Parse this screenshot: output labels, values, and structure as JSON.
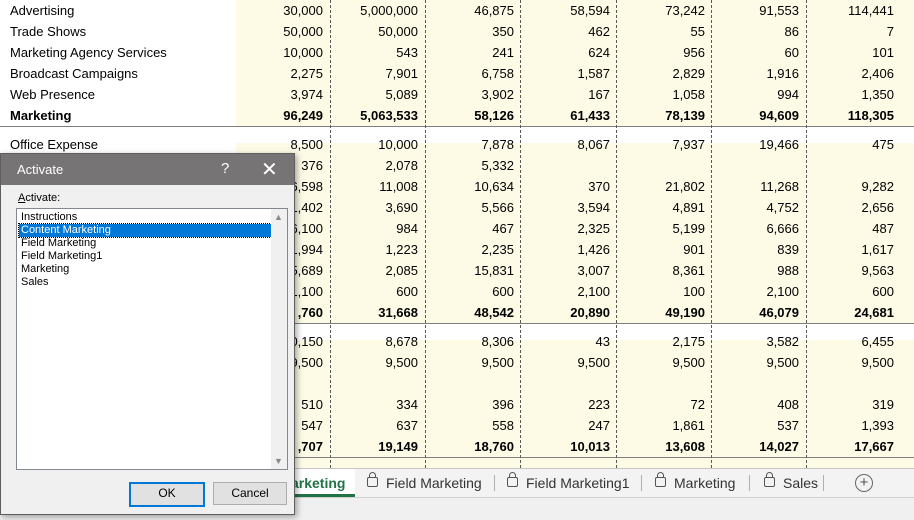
{
  "sheet": {
    "rows": [
      {
        "label": "Advertising",
        "values": [
          "30,000",
          "5,000,000",
          "46,875",
          "58,594",
          "73,242",
          "91,553",
          "114,441"
        ]
      },
      {
        "label": "Trade Shows",
        "values": [
          "50,000",
          "50,000",
          "350",
          "462",
          "55",
          "86",
          "7"
        ]
      },
      {
        "label": "Marketing Agency Services",
        "values": [
          "10,000",
          "543",
          "241",
          "624",
          "956",
          "60",
          "101"
        ]
      },
      {
        "label": "Broadcast Campaigns",
        "values": [
          "2,275",
          "7,901",
          "6,758",
          "1,587",
          "2,829",
          "1,916",
          "2,406"
        ]
      },
      {
        "label": "Web Presence",
        "values": [
          "3,974",
          "5,089",
          "3,902",
          "167",
          "1,058",
          "994",
          "1,350"
        ]
      },
      {
        "label": "Marketing",
        "values": [
          "96,249",
          "5,063,533",
          "58,126",
          "61,433",
          "78,139",
          "94,609",
          "118,305"
        ],
        "bold": true
      },
      {
        "label": "Office Expense",
        "values": [
          "8,500",
          "10,000",
          "7,878",
          "8,067",
          "7,937",
          "19,466",
          "475"
        ]
      },
      {
        "label": "",
        "values": [
          "376",
          "2,078",
          "5,332",
          "",
          "",
          "",
          ""
        ]
      },
      {
        "label": "",
        "values": [
          "6,598",
          "11,008",
          "10,634",
          "370",
          "21,802",
          "11,268",
          "9,282"
        ]
      },
      {
        "label": "",
        "values": [
          "1,402",
          "3,690",
          "5,566",
          "3,594",
          "4,891",
          "4,752",
          "2,656"
        ]
      },
      {
        "label": "",
        "values": [
          "6,100",
          "984",
          "467",
          "2,325",
          "5,199",
          "6,666",
          "487"
        ]
      },
      {
        "label": "",
        "values": [
          "1,994",
          "1,223",
          "2,235",
          "1,426",
          "901",
          "839",
          "1,617"
        ]
      },
      {
        "label": "",
        "values": [
          "5,689",
          "2,085",
          "15,831",
          "3,007",
          "8,361",
          "988",
          "9,563"
        ]
      },
      {
        "label": "",
        "values": [
          "1,100",
          "600",
          "600",
          "2,100",
          "100",
          "2,100",
          "600"
        ]
      },
      {
        "label": "",
        "values": [
          ",760",
          "31,668",
          "48,542",
          "20,890",
          "49,190",
          "46,079",
          "24,681"
        ],
        "bold": true
      },
      {
        "label": "",
        "values": [
          "0,150",
          "8,678",
          "8,306",
          "43",
          "2,175",
          "3,582",
          "6,455"
        ]
      },
      {
        "label": "",
        "values": [
          "9,500",
          "9,500",
          "9,500",
          "9,500",
          "9,500",
          "9,500",
          "9,500"
        ]
      },
      {
        "label": "",
        "values": [
          "",
          "",
          "",
          "",
          "",
          "",
          ""
        ]
      },
      {
        "label": "",
        "values": [
          "510",
          "334",
          "396",
          "223",
          "72",
          "408",
          "319"
        ]
      },
      {
        "label": "",
        "values": [
          "547",
          "637",
          "558",
          "247",
          "1,861",
          "537",
          "1,393"
        ]
      },
      {
        "label": "",
        "values": [
          ",707",
          "19,149",
          "18,760",
          "10,013",
          "13,608",
          "14,027",
          "17,667"
        ],
        "bold": true
      }
    ]
  },
  "tabs": [
    {
      "label": "arketing",
      "active": true
    },
    {
      "label": "Field Marketing",
      "active": false
    },
    {
      "label": "Field Marketing1",
      "active": false
    },
    {
      "label": "Marketing",
      "active": false
    },
    {
      "label": "Sales",
      "active": false
    }
  ],
  "add_sheet_symbol": "+",
  "dialog": {
    "title": "Activate",
    "help": "?",
    "close": "✕",
    "list_label": "Activate:",
    "items": [
      "Instructions",
      "Content Marketing",
      "Field Marketing",
      "Field Marketing1",
      "Marketing",
      "Sales"
    ],
    "selected": "Content Marketing",
    "ok_label": "OK",
    "cancel_label": "Cancel",
    "scroll_up": "▲",
    "scroll_down": "▼"
  }
}
